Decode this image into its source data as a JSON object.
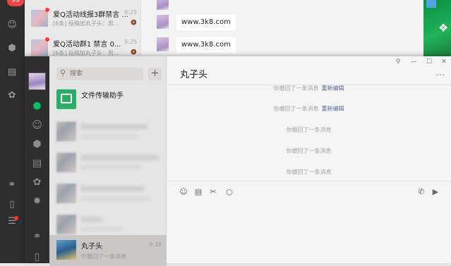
{
  "background_window": {
    "badge": "99",
    "chats": [
      {
        "name": "爱Q活动线报3群禁言 ...",
        "time": "9:25",
        "preview": "[6条] 投稿加丸子头：男..."
      },
      {
        "name": "爱Q活动群1 禁言 0...",
        "time": "9:25",
        "preview": "[6条] 投稿加丸子头：男..."
      }
    ],
    "messages": [
      "www.3k8.com",
      "www.3k8.com"
    ]
  },
  "main_window": {
    "search": {
      "placeholder": "搜索"
    },
    "add_label": "+",
    "pinned": {
      "title": "文件传输助手"
    },
    "active_chat": {
      "name": "丸子头",
      "time": "9:38",
      "preview": "你撤回了一条消息"
    },
    "chat_title": "丸子头",
    "window_controls": [
      "⚲",
      "—",
      "☐",
      "✕"
    ],
    "more_label": "···",
    "system_messages": [
      {
        "text": "你撤回了一条消息",
        "link": "重新编辑"
      },
      {
        "text": "你撤回了一条消息",
        "link": "重新编辑"
      },
      {
        "text": "你撤回了一条消息",
        "link": ""
      },
      {
        "text": "你撤回了一条消息",
        "link": ""
      },
      {
        "text": "你撤回了一条消息",
        "link": ""
      }
    ]
  }
}
